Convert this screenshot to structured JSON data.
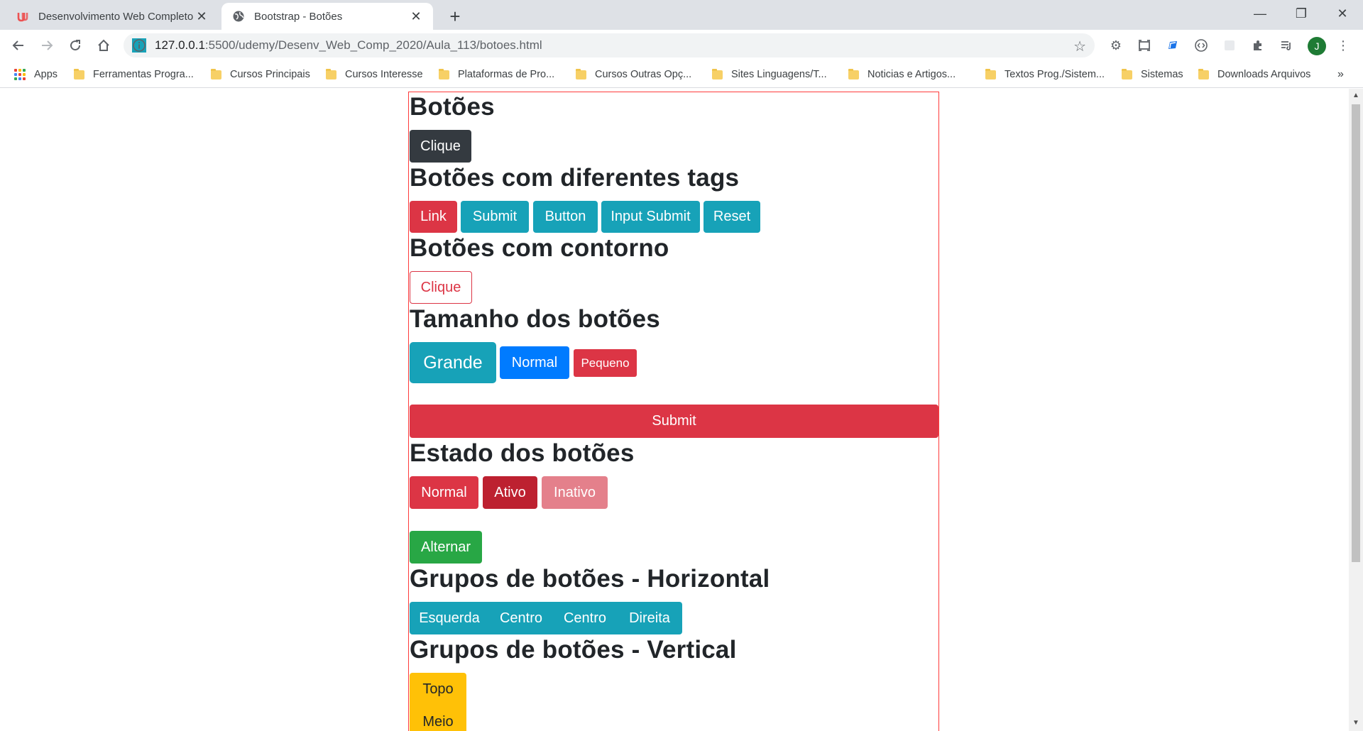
{
  "browser": {
    "tabs": [
      {
        "title": "Desenvolvimento Web Completo"
      },
      {
        "title": "Bootstrap - Botões"
      }
    ],
    "url_host": "127.0.0.1",
    "url_path": ":5500/udemy/Desenv_Web_Comp_2020/Aula_113/botoes.html",
    "avatar_letter": "J",
    "bookmarks": [
      {
        "label": "Apps"
      },
      {
        "label": "Ferramentas Progra..."
      },
      {
        "label": "Cursos Principais"
      },
      {
        "label": "Cursos Interesse"
      },
      {
        "label": "Plataformas de Pro..."
      },
      {
        "label": "Cursos Outras Opç..."
      },
      {
        "label": "Sites Linguagens/T..."
      },
      {
        "label": "Noticias e Artigos..."
      },
      {
        "label": "Textos Prog./Sistem..."
      },
      {
        "label": "Sistemas"
      },
      {
        "label": "Downloads Arquivos"
      }
    ],
    "overflow": "»"
  },
  "page": {
    "sections": [
      {
        "heading": "Botões"
      },
      {
        "heading": "Botões com diferentes tags"
      },
      {
        "heading": "Botões com contorno"
      },
      {
        "heading": "Tamanho dos botões"
      },
      {
        "heading": "Estado dos botões"
      },
      {
        "heading": "Grupos de botões - Horizontal"
      },
      {
        "heading": "Grupos de botões - Vertical"
      }
    ],
    "basic": {
      "label": "Clique"
    },
    "tags": [
      {
        "label": "Link"
      },
      {
        "label": "Submit"
      },
      {
        "label": "Button"
      },
      {
        "label": "Input Submit"
      },
      {
        "label": "Reset"
      }
    ],
    "outline": {
      "label": "Clique"
    },
    "sizes": [
      {
        "label": "Grande"
      },
      {
        "label": "Normal"
      },
      {
        "label": "Pequeno"
      }
    ],
    "block": {
      "label": "Submit"
    },
    "states": [
      {
        "label": "Normal"
      },
      {
        "label": "Ativo"
      },
      {
        "label": "Inativo"
      }
    ],
    "toggle": {
      "label": "Alternar"
    },
    "hgroup": [
      {
        "label": "Esquerda"
      },
      {
        "label": "Centro"
      },
      {
        "label": "Centro"
      },
      {
        "label": "Direita"
      }
    ],
    "vgroup": [
      {
        "label": "Topo"
      },
      {
        "label": "Meio"
      }
    ]
  },
  "colors": {
    "dark": "#343a40",
    "danger": "#dc3545",
    "info": "#17a2b8",
    "primary": "#007bff",
    "success": "#28a745",
    "warning": "#ffc107",
    "container_border": "#ff3b3b"
  }
}
